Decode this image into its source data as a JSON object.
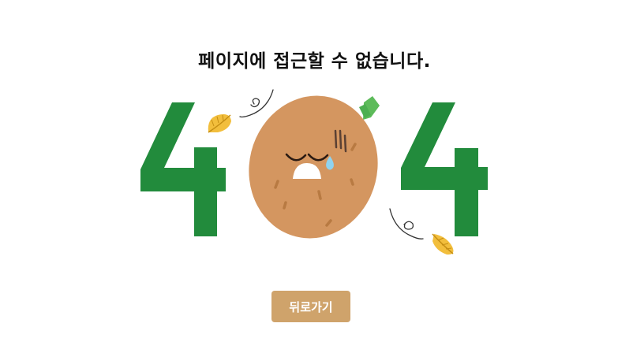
{
  "page": {
    "title": "페이지에 접근할 수 없습니다.",
    "error_code": "404"
  },
  "actions": {
    "back_label": "뒤로가기"
  },
  "colors": {
    "digit_green": "#228B3C",
    "potato_brown": "#D49660",
    "leaf_yellow": "#F2BE3C",
    "button_tan": "#CFA36B",
    "sprout_green": "#5DBB5A"
  },
  "icons": {
    "potato": "sad-potato-icon",
    "leaf": "leaf-icon"
  }
}
